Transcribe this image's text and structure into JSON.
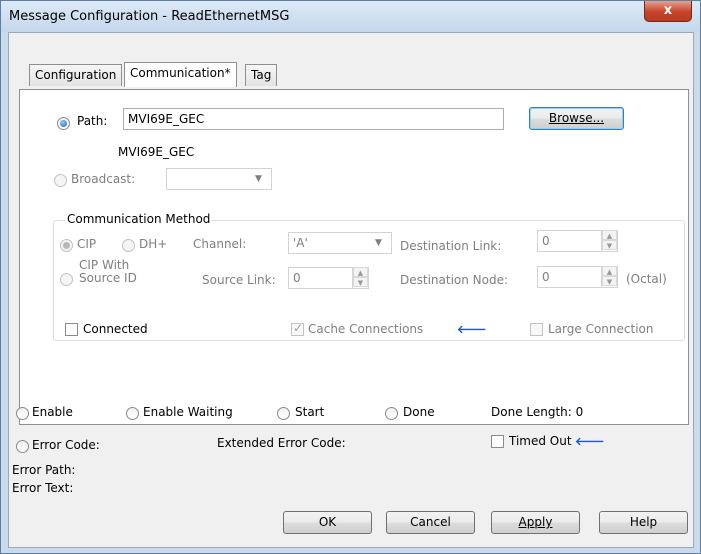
{
  "window": {
    "title": "Message Configuration - ReadEthernetMSG",
    "close_glyph": "x"
  },
  "tabs": [
    {
      "label": "Configuration"
    },
    {
      "label": "Communication*"
    },
    {
      "label": "Tag"
    }
  ],
  "path": {
    "label": "Path:",
    "value": "MVI69E_GEC",
    "resolved": "MVI69E_GEC",
    "browse_label": "Browse..."
  },
  "broadcast": {
    "label": "Broadcast:",
    "value": ""
  },
  "comm_method": {
    "group_label": "Communication Method",
    "cip_label": "CIP",
    "dhplus_label": "DH+",
    "cip_with_source_line1": "CIP With",
    "cip_with_source_line2": "Source ID",
    "channel_label": "Channel:",
    "channel_value": "'A'",
    "source_link_label": "Source Link:",
    "source_link_value": "0",
    "dest_link_label": "Destination Link:",
    "dest_link_value": "0",
    "dest_node_label": "Destination Node:",
    "dest_node_value": "0",
    "octal_label": "(Octal)"
  },
  "options": {
    "connected_label": "Connected",
    "cache_label": "Cache Connections",
    "large_label": "Large Connection"
  },
  "status": {
    "enable": "Enable",
    "enable_waiting": "Enable Waiting",
    "start": "Start",
    "done": "Done",
    "done_length": "Done Length: 0",
    "error_code": "Error Code:",
    "extended_error_code": "Extended Error Code:",
    "timed_out": "Timed Out",
    "error_path": "Error Path:",
    "error_text": "Error Text:"
  },
  "buttons": {
    "ok": "OK",
    "cancel": "Cancel",
    "apply": "Apply",
    "help": "Help"
  },
  "colors": {
    "accent_arrow": "#1c55d6",
    "close_button": "#c6432a"
  }
}
